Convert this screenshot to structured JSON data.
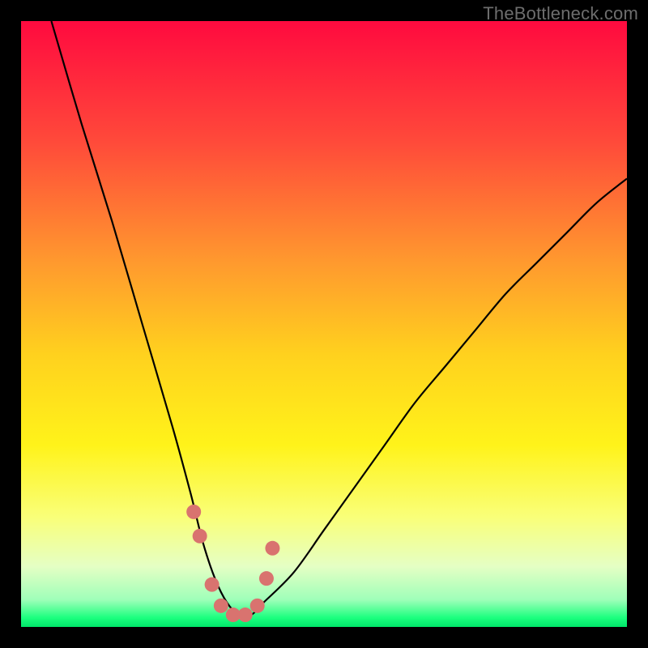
{
  "watermark": "TheBottleneck.com",
  "chart_data": {
    "type": "line",
    "title": "",
    "xlabel": "",
    "ylabel": "",
    "xlim": [
      0,
      100
    ],
    "ylim": [
      0,
      100
    ],
    "series": [
      {
        "name": "bottleneck-curve",
        "x": [
          5,
          10,
          15,
          20,
          25,
          28,
          30,
          32,
          34,
          36,
          38,
          40,
          45,
          50,
          55,
          60,
          65,
          70,
          75,
          80,
          85,
          90,
          95,
          100
        ],
        "y": [
          100,
          83,
          67,
          50,
          33,
          22,
          14,
          8,
          4,
          2,
          2,
          4,
          9,
          16,
          23,
          30,
          37,
          43,
          49,
          55,
          60,
          65,
          70,
          74
        ]
      }
    ],
    "markers": {
      "name": "highlight-points",
      "x": [
        28.5,
        29.5,
        31.5,
        33.0,
        35.0,
        37.0,
        39.0,
        40.5,
        41.5
      ],
      "y": [
        19,
        15,
        7,
        3.5,
        2,
        2,
        3.5,
        8,
        13
      ]
    },
    "gradient_stops": [
      {
        "offset": 0.0,
        "color": "#ff0a3f"
      },
      {
        "offset": 0.2,
        "color": "#ff4a3a"
      },
      {
        "offset": 0.4,
        "color": "#ff9a2e"
      },
      {
        "offset": 0.55,
        "color": "#ffd11e"
      },
      {
        "offset": 0.7,
        "color": "#fff31a"
      },
      {
        "offset": 0.82,
        "color": "#f9ff7a"
      },
      {
        "offset": 0.9,
        "color": "#e5ffc4"
      },
      {
        "offset": 0.955,
        "color": "#9fffb9"
      },
      {
        "offset": 0.985,
        "color": "#1bff7e"
      },
      {
        "offset": 1.0,
        "color": "#00e66a"
      }
    ],
    "marker_color": "#d9736f",
    "curve_color": "#000000"
  }
}
